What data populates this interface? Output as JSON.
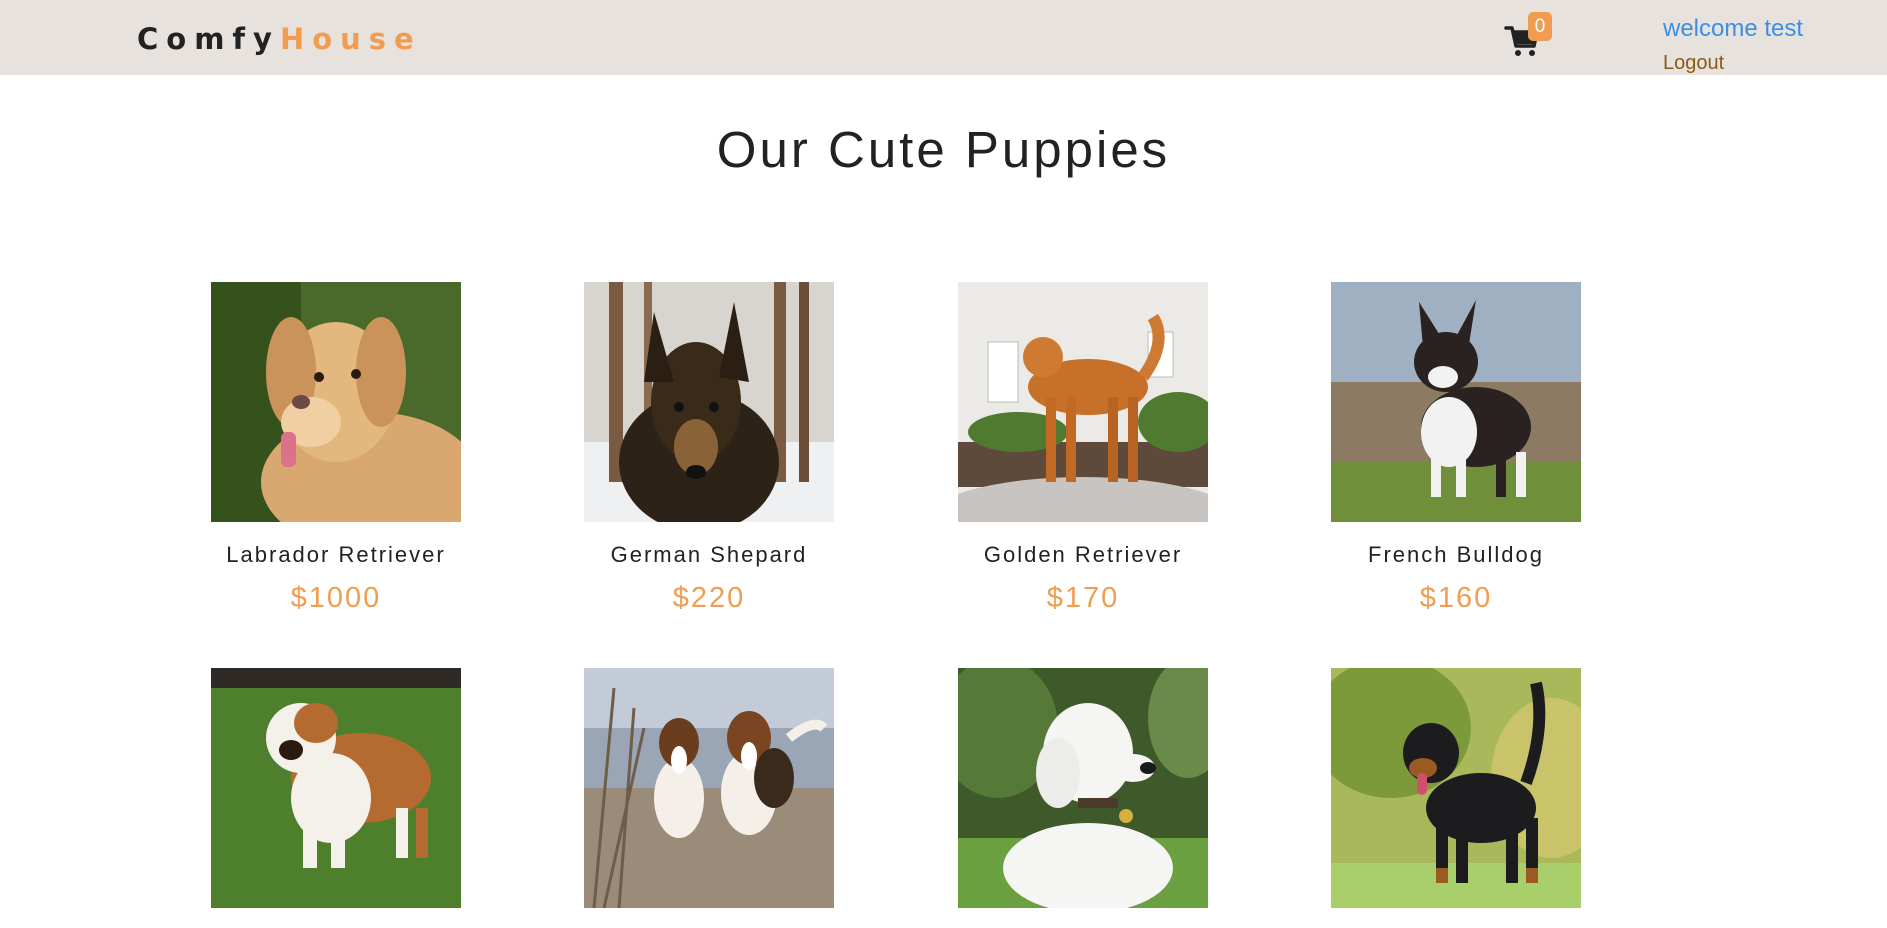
{
  "navbar": {
    "logo_part1": "Comfy",
    "logo_part2": "House",
    "cart_icon": "shopping-cart-icon",
    "cart_count": "0",
    "welcome_text": "welcome test",
    "logout_label": "Logout"
  },
  "page": {
    "title": "Our Cute Puppies"
  },
  "products": [
    {
      "name": "Labrador Retriever",
      "price": "$1000"
    },
    {
      "name": "German Shepard",
      "price": "$220"
    },
    {
      "name": "Golden Retriever",
      "price": "$170"
    },
    {
      "name": "French Bulldog",
      "price": "$160"
    },
    {
      "name": "",
      "price": ""
    },
    {
      "name": "",
      "price": ""
    },
    {
      "name": "",
      "price": ""
    },
    {
      "name": "",
      "price": ""
    }
  ],
  "colors": {
    "navbar_bg": "#e7e2de",
    "accent": "#f09d51",
    "welcome": "#3d8fe3",
    "logout": "#8b5a14"
  }
}
